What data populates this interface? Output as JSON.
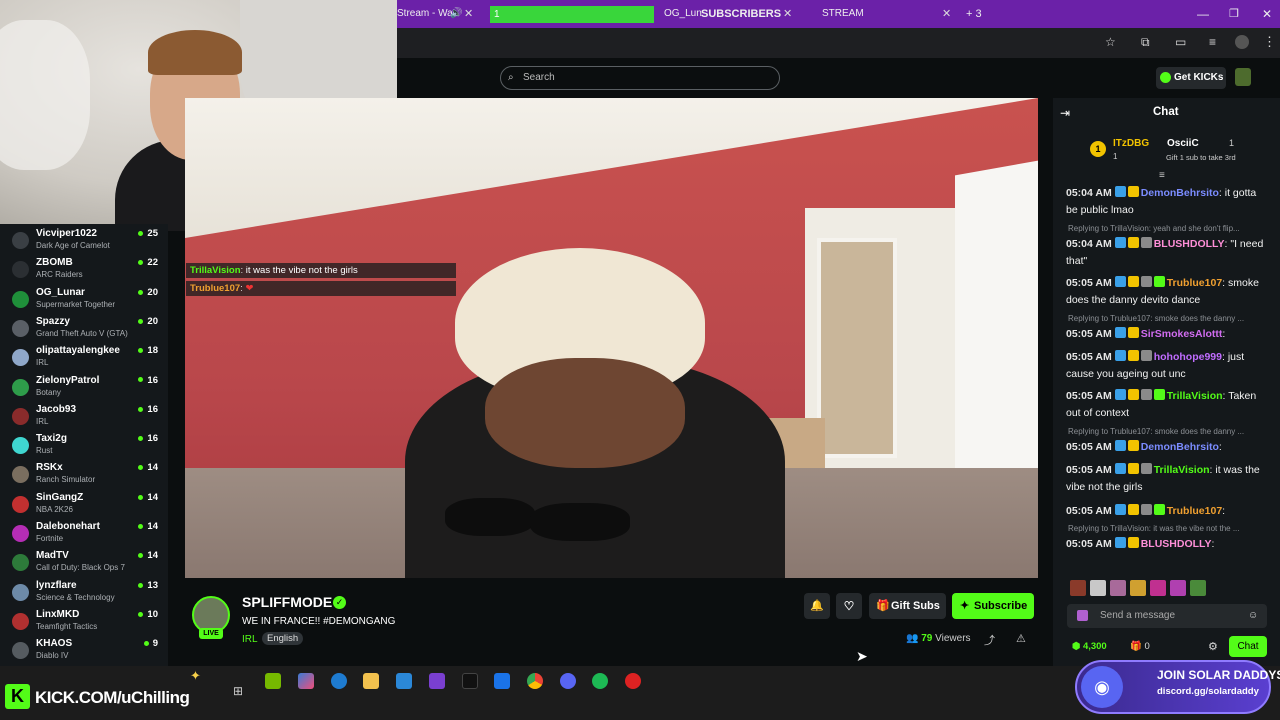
{
  "browser": {
    "tabs": [
      {
        "label": "Stream - Wat"
      },
      {
        "label": "1"
      },
      {
        "label": "OG_Lunar"
      },
      {
        "label": "SUBSCRIBERS"
      },
      {
        "label": "STREAM"
      }
    ],
    "tab_overflow": "+ 3"
  },
  "header": {
    "search_placeholder": "Search",
    "get_kicks_label": "Get KICKs"
  },
  "sidebar": {
    "channels": [
      {
        "name": "Vicviper1022",
        "category": "Dark Age of Camelot",
        "viewers": "25",
        "avatar_color": "#3a3f44"
      },
      {
        "name": "ZBOMB",
        "category": "ARC Raiders",
        "viewers": "22",
        "avatar_color": "#2b2f33"
      },
      {
        "name": "OG_Lunar",
        "category": "Supermarket Together",
        "viewers": "20",
        "avatar_color": "#1f8f3a"
      },
      {
        "name": "Spazzy",
        "category": "Grand Theft Auto V (GTA)",
        "viewers": "20",
        "avatar_color": "#5a5f66"
      },
      {
        "name": "olipattayalengkee",
        "category": "IRL",
        "viewers": "18",
        "avatar_color": "#8fa7c9"
      },
      {
        "name": "ZielonyPatrol",
        "category": "Botany",
        "viewers": "16",
        "avatar_color": "#2e9c4a"
      },
      {
        "name": "Jacob93",
        "category": "IRL",
        "viewers": "16",
        "avatar_color": "#8a2b2b"
      },
      {
        "name": "Taxi2g",
        "category": "Rust",
        "viewers": "16",
        "avatar_color": "#3fd6d0"
      },
      {
        "name": "RSKx",
        "category": "Ranch Simulator",
        "viewers": "14",
        "avatar_color": "#7a6e5f"
      },
      {
        "name": "SinGangZ",
        "category": "NBA 2K26",
        "viewers": "14",
        "avatar_color": "#c23030"
      },
      {
        "name": "Dalebonehart",
        "category": "Fortnite",
        "viewers": "14",
        "avatar_color": "#b52db5"
      },
      {
        "name": "MadTV",
        "category": "Call of Duty: Black Ops 7",
        "viewers": "14",
        "avatar_color": "#2d7a3a"
      },
      {
        "name": "lynzflare",
        "category": "Science & Technology",
        "viewers": "13",
        "avatar_color": "#6d8aa8"
      },
      {
        "name": "LinxMKD",
        "category": "Teamfight Tactics",
        "viewers": "10",
        "avatar_color": "#b03030"
      },
      {
        "name": "KHAOS",
        "category": "Diablo IV",
        "viewers": "9",
        "avatar_color": "#555b60"
      }
    ]
  },
  "video_overlay": [
    {
      "user": "TrillaVision",
      "text": "it was the vibe not the girls"
    },
    {
      "user": "Trublue107",
      "text": ""
    }
  ],
  "stream": {
    "streamer": "SPLIFFMODE",
    "title": "WE IN FRANCE!! #DEMONGANG",
    "category": "IRL",
    "language": "English",
    "live_label": "LIVE",
    "viewers": "79",
    "viewers_label": "Viewers",
    "gift_subs_label": "Gift Subs",
    "subscribe_label": "Subscribe"
  },
  "chat": {
    "title": "Chat",
    "leaderboard": [
      {
        "rank": "1",
        "name": "ITzDBG",
        "count": "1"
      },
      {
        "name": "OsciiC",
        "count": "1",
        "note": "Gift 1 sub to take 3rd"
      }
    ],
    "messages": [
      {
        "time": "05:04 AM",
        "user": "DemonBehrsito",
        "color": "#7b8cff",
        "text": "it gotta be public lmao",
        "reply": ""
      },
      {
        "time": "05:04 AM",
        "user": "BLUSHDOLLY",
        "color": "#ff8fd8",
        "text": "\"I need that\"",
        "reply": "Replying to TrillaVision: yeah and she don't flip..."
      },
      {
        "time": "05:05 AM",
        "user": "Trublue107",
        "color": "#f0a030",
        "text": "smoke does the danny devito dance",
        "reply": ""
      },
      {
        "time": "05:05 AM",
        "user": "SirSmokesAlottt",
        "color": "#d16cf0",
        "text": "",
        "reply": "Replying to Trublue107: smoke does the danny ..."
      },
      {
        "time": "05:05 AM",
        "user": "hohohope999",
        "color": "#c06cff",
        "text": "just cause you ageing out unc",
        "reply": ""
      },
      {
        "time": "05:05 AM",
        "user": "TrillaVision",
        "color": "#53fc18",
        "text": "Taken out of context",
        "reply": ""
      },
      {
        "time": "05:05 AM",
        "user": "DemonBehrsito",
        "color": "#7b8cff",
        "text": "",
        "reply": "Replying to Trublue107: smoke does the danny ..."
      },
      {
        "time": "05:05 AM",
        "user": "TrillaVision",
        "color": "#53fc18",
        "text": "it was the vibe not the girls",
        "reply": ""
      },
      {
        "time": "05:05 AM",
        "user": "Trublue107",
        "color": "#f0a030",
        "text": "",
        "reply": ""
      },
      {
        "time": "05:05 AM",
        "user": "BLUSHDOLLY",
        "color": "#ff8fd8",
        "text": "",
        "reply": "Replying to TrillaVision: it was the vibe not the ..."
      }
    ],
    "input_placeholder": "Send a message",
    "kicks_balance": "4,300",
    "gift_count": "0",
    "send_label": "Chat"
  },
  "taskbar": {
    "overlay_text": "KICK.COM/uChilling",
    "discord_promo_title": "JOIN SOLAR DADDYS",
    "discord_promo_link": "discord.gg/solardaddy"
  }
}
